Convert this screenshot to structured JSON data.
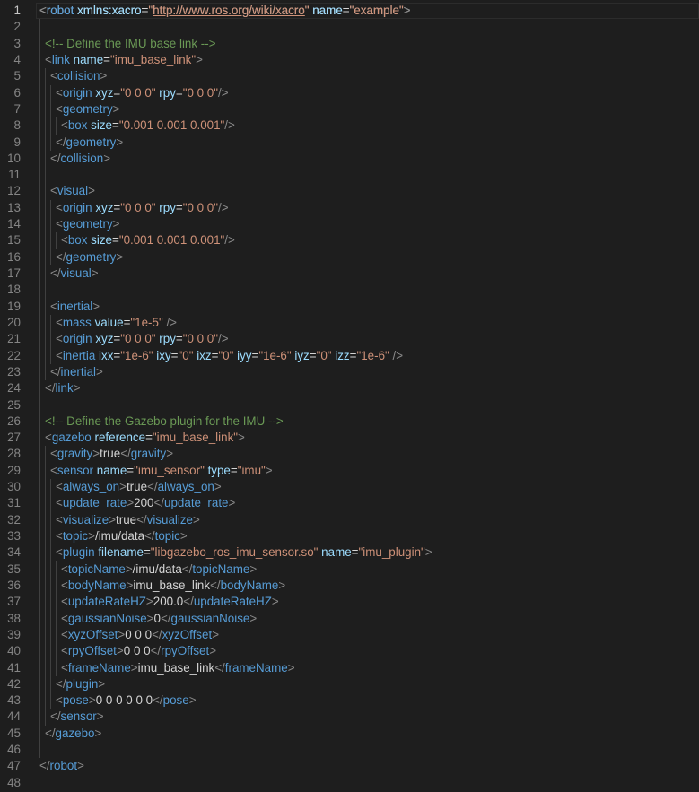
{
  "editor": {
    "active_line": 1,
    "colors": {
      "background": "#1e1e1e",
      "tag": "#569cd6",
      "punctuation": "#808080",
      "attribute": "#9cdcfe",
      "string": "#ce9178",
      "comment": "#6a9955",
      "text": "#d4d4d4"
    },
    "lines": [
      {
        "n": "1",
        "i": 0,
        "g": 0,
        "text": "<robot xmlns:xacro=\"http://www.ros.org/wiki/xacro\" name=\"example\">"
      },
      {
        "n": "2",
        "i": 0,
        "g": 1,
        "text": ""
      },
      {
        "n": "3",
        "i": 1,
        "g": 1,
        "text": "<!-- Define the IMU base link -->"
      },
      {
        "n": "4",
        "i": 1,
        "g": 1,
        "text": "<link name=\"imu_base_link\">"
      },
      {
        "n": "5",
        "i": 2,
        "g": 2,
        "text": "<collision>"
      },
      {
        "n": "6",
        "i": 3,
        "g": 3,
        "text": "<origin xyz=\"0 0 0\" rpy=\"0 0 0\"/>"
      },
      {
        "n": "7",
        "i": 3,
        "g": 3,
        "text": "<geometry>"
      },
      {
        "n": "8",
        "i": 4,
        "g": 4,
        "text": "<box size=\"0.001 0.001 0.001\"/>"
      },
      {
        "n": "9",
        "i": 3,
        "g": 3,
        "text": "</geometry>"
      },
      {
        "n": "10",
        "i": 2,
        "g": 2,
        "text": "</collision>"
      },
      {
        "n": "11",
        "i": 0,
        "g": 2,
        "text": ""
      },
      {
        "n": "12",
        "i": 2,
        "g": 2,
        "text": "<visual>"
      },
      {
        "n": "13",
        "i": 3,
        "g": 3,
        "text": "<origin xyz=\"0 0 0\" rpy=\"0 0 0\"/>"
      },
      {
        "n": "14",
        "i": 3,
        "g": 3,
        "text": "<geometry>"
      },
      {
        "n": "15",
        "i": 4,
        "g": 4,
        "text": "<box size=\"0.001 0.001 0.001\"/>"
      },
      {
        "n": "16",
        "i": 3,
        "g": 3,
        "text": "</geometry>"
      },
      {
        "n": "17",
        "i": 2,
        "g": 2,
        "text": "</visual>"
      },
      {
        "n": "18",
        "i": 0,
        "g": 2,
        "text": ""
      },
      {
        "n": "19",
        "i": 2,
        "g": 2,
        "text": "<inertial>"
      },
      {
        "n": "20",
        "i": 3,
        "g": 3,
        "text": "<mass value=\"1e-5\" />"
      },
      {
        "n": "21",
        "i": 3,
        "g": 3,
        "text": "<origin xyz=\"0 0 0\" rpy=\"0 0 0\"/>"
      },
      {
        "n": "22",
        "i": 3,
        "g": 3,
        "text": "<inertia ixx=\"1e-6\" ixy=\"0\" ixz=\"0\" iyy=\"1e-6\" iyz=\"0\" izz=\"1e-6\" />"
      },
      {
        "n": "23",
        "i": 2,
        "g": 2,
        "text": "</inertial>"
      },
      {
        "n": "24",
        "i": 1,
        "g": 1,
        "text": "</link>"
      },
      {
        "n": "25",
        "i": 0,
        "g": 1,
        "text": ""
      },
      {
        "n": "26",
        "i": 1,
        "g": 1,
        "text": "<!-- Define the Gazebo plugin for the IMU -->"
      },
      {
        "n": "27",
        "i": 1,
        "g": 1,
        "text": "<gazebo reference=\"imu_base_link\">"
      },
      {
        "n": "28",
        "i": 2,
        "g": 2,
        "text": "<gravity>true</gravity>"
      },
      {
        "n": "29",
        "i": 2,
        "g": 2,
        "text": "<sensor name=\"imu_sensor\" type=\"imu\">"
      },
      {
        "n": "30",
        "i": 3,
        "g": 3,
        "text": "<always_on>true</always_on>"
      },
      {
        "n": "31",
        "i": 3,
        "g": 3,
        "text": "<update_rate>200</update_rate>"
      },
      {
        "n": "32",
        "i": 3,
        "g": 3,
        "text": "<visualize>true</visualize>"
      },
      {
        "n": "33",
        "i": 3,
        "g": 3,
        "text": "<topic>/imu/data</topic>"
      },
      {
        "n": "34",
        "i": 3,
        "g": 3,
        "text": "<plugin filename=\"libgazebo_ros_imu_sensor.so\" name=\"imu_plugin\">"
      },
      {
        "n": "35",
        "i": 4,
        "g": 4,
        "text": "<topicName>/imu/data</topicName>"
      },
      {
        "n": "36",
        "i": 4,
        "g": 4,
        "text": "<bodyName>imu_base_link</bodyName>"
      },
      {
        "n": "37",
        "i": 4,
        "g": 4,
        "text": "<updateRateHZ>200.0</updateRateHZ>"
      },
      {
        "n": "38",
        "i": 4,
        "g": 4,
        "text": "<gaussianNoise>0</gaussianNoise>"
      },
      {
        "n": "39",
        "i": 4,
        "g": 4,
        "text": "<xyzOffset>0 0 0</xyzOffset>"
      },
      {
        "n": "40",
        "i": 4,
        "g": 4,
        "text": "<rpyOffset>0 0 0</rpyOffset>"
      },
      {
        "n": "41",
        "i": 4,
        "g": 4,
        "text": "<frameName>imu_base_link</frameName>"
      },
      {
        "n": "42",
        "i": 3,
        "g": 3,
        "text": "</plugin>"
      },
      {
        "n": "43",
        "i": 3,
        "g": 3,
        "text": "<pose>0 0 0 0 0 0</pose>"
      },
      {
        "n": "44",
        "i": 2,
        "g": 2,
        "text": "</sensor>"
      },
      {
        "n": "45",
        "i": 1,
        "g": 1,
        "text": "</gazebo>"
      },
      {
        "n": "46",
        "i": 0,
        "g": 1,
        "text": ""
      },
      {
        "n": "47",
        "i": 0,
        "g": 0,
        "text": "</robot>"
      },
      {
        "n": "48",
        "i": 0,
        "g": 0,
        "text": ""
      }
    ]
  }
}
